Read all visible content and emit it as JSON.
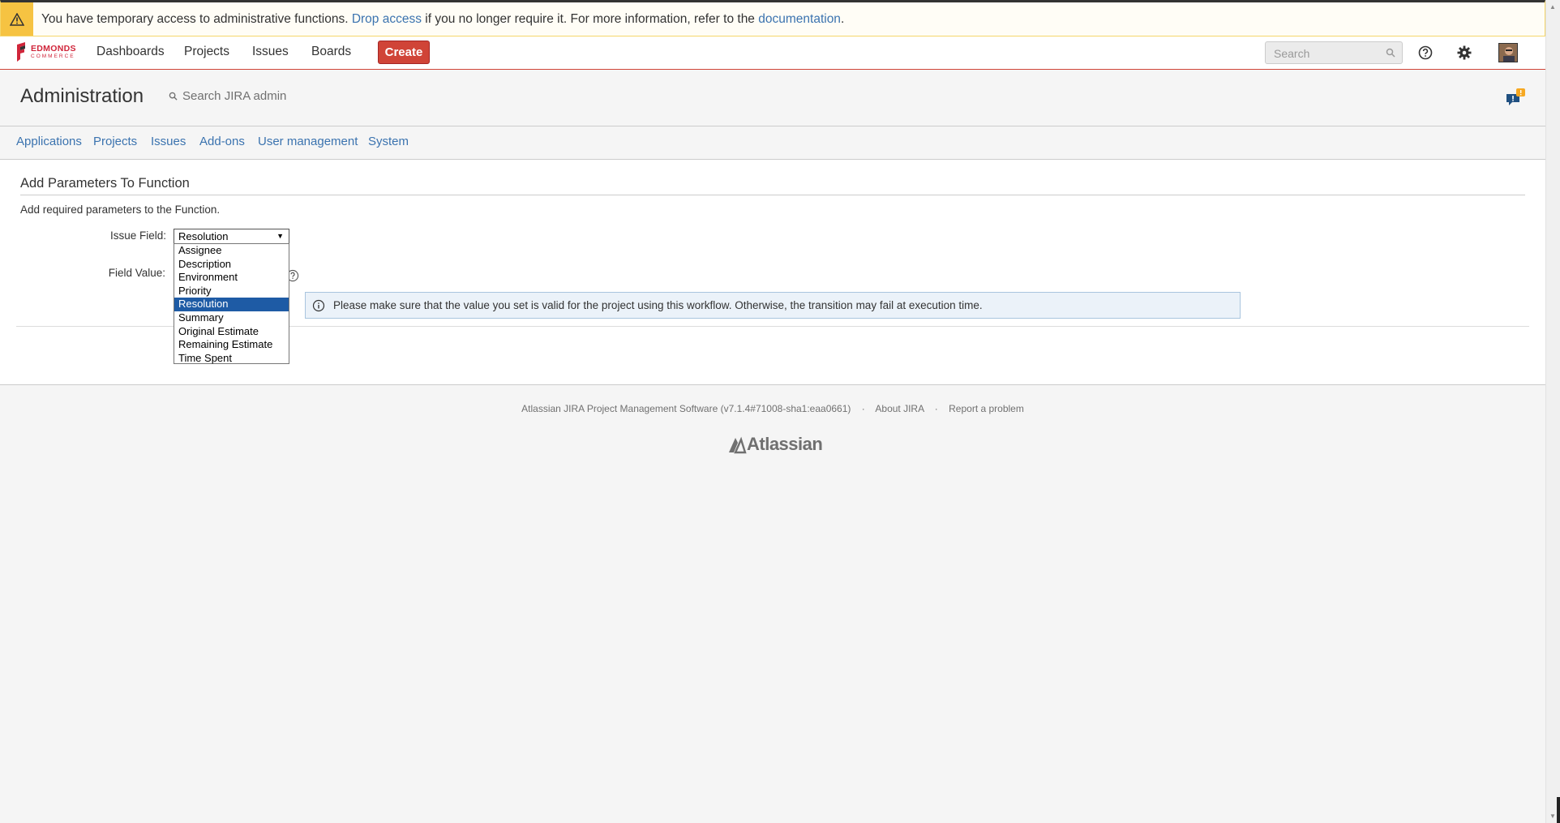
{
  "banner": {
    "text_before": "You have temporary access to administrative functions.",
    "drop_access": "Drop access",
    "text_middle": "if you no longer require it. For more information, refer to the",
    "documentation": "documentation",
    "text_after": "."
  },
  "logo": {
    "line1": "EDMONDS",
    "line2": "COMMERCE"
  },
  "nav": {
    "dashboards": "Dashboards",
    "projects": "Projects",
    "issues": "Issues",
    "boards": "Boards",
    "create": "Create",
    "search_placeholder": "Search"
  },
  "admin": {
    "title": "Administration",
    "search_label": "Search JIRA admin"
  },
  "tabs": [
    "Applications",
    "Projects",
    "Issues",
    "Add-ons",
    "User management",
    "System"
  ],
  "form": {
    "heading": "Add Parameters To Function",
    "description": "Add required parameters to the Function.",
    "issue_field_label": "Issue Field:",
    "field_value_label": "Field Value:",
    "selected_value": "Resolution",
    "options": [
      "Assignee",
      "Description",
      "Environment",
      "Priority",
      "Resolution",
      "Summary",
      "Original Estimate",
      "Remaining Estimate",
      "Time Spent"
    ],
    "info_message": "Please make sure that the value you set is valid for the project using this workflow. Otherwise, the transition may fail at execution time."
  },
  "footer": {
    "version": "Atlassian JIRA Project Management Software (v7.1.4#71008-sha1:eaa0661)",
    "sep": "·",
    "about": "About JIRA",
    "report": "Report a problem",
    "atlassian": "Atlassian"
  },
  "colors": {
    "accent_red": "#d04437",
    "link_blue": "#3b73af",
    "warning_yellow": "#f6c342",
    "selected_option": "#1e5ba5"
  }
}
